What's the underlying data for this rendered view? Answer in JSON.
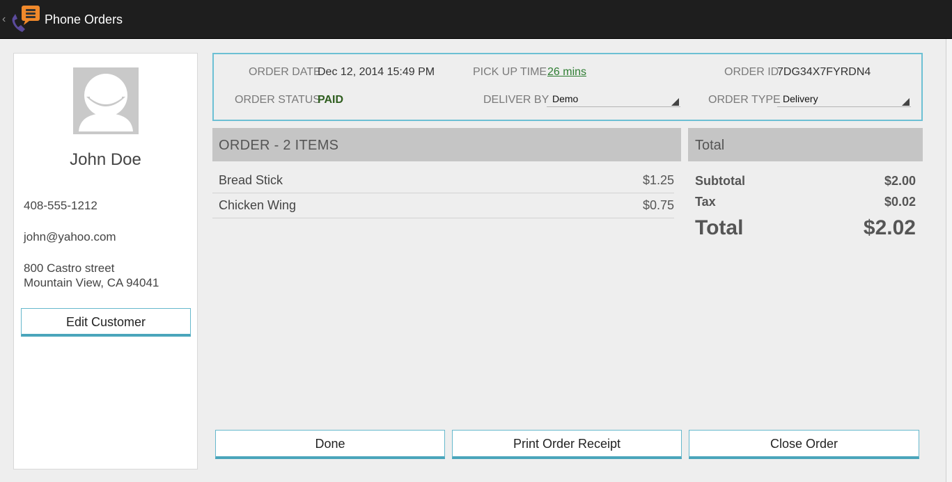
{
  "app": {
    "title": "Phone Orders",
    "back_glyph": "‹",
    "icon": "phone-orders-app-icon"
  },
  "customer": {
    "name": "John Doe",
    "phone": "408-555-1212",
    "email": "john@yahoo.com",
    "address_line1": "800 Castro street",
    "address_line2": "Mountain View, CA 94041",
    "edit_button": "Edit Customer",
    "avatar_icon": "person-avatar-icon"
  },
  "order_info": {
    "order_date_label": "ORDER DATE",
    "order_date": "Dec 12, 2014 15:49 PM",
    "pickup_time_label": "PICK UP TIME",
    "pickup_time": "26 mins",
    "order_id_label": "ORDER ID",
    "order_id": "7DG34X7FYRDN4",
    "order_status_label": "ORDER STATUS",
    "order_status": "PAID",
    "deliver_by_label": "DELIVER BY",
    "deliver_by": "Demo",
    "order_type_label": "ORDER TYPE",
    "order_type": "Delivery"
  },
  "order": {
    "header": "ORDER - 2 ITEMS",
    "items": [
      {
        "name": "Bread Stick",
        "price": "$1.25"
      },
      {
        "name": "Chicken Wing",
        "price": "$0.75"
      }
    ]
  },
  "totals": {
    "header": "Total",
    "subtotal_label": "Subtotal",
    "subtotal": "$2.00",
    "tax_label": "Tax",
    "tax": "$0.02",
    "total_label": "Total",
    "total": "$2.02"
  },
  "actions": {
    "done": "Done",
    "print": "Print Order Receipt",
    "close": "Close Order"
  },
  "colors": {
    "accent": "#4aa5bb",
    "topbar": "#1e1e1e",
    "paid": "#2e5d1e",
    "link": "#2e7d32",
    "app_icon_orange": "#f0892b",
    "app_icon_purple": "#5b4b9c"
  }
}
